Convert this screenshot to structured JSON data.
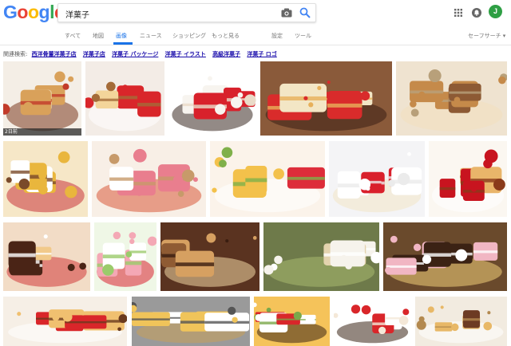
{
  "logo": {
    "letters": [
      {
        "ch": "G",
        "color": "#4285F4"
      },
      {
        "ch": "o",
        "color": "#EA4335"
      },
      {
        "ch": "o",
        "color": "#FBBC05"
      },
      {
        "ch": "g",
        "color": "#4285F4"
      },
      {
        "ch": "l",
        "color": "#34A853"
      },
      {
        "ch": "e",
        "color": "#EA4335"
      }
    ]
  },
  "search": {
    "query": "洋菓子"
  },
  "account": {
    "initial": "J",
    "color": "#2e9f44"
  },
  "tabs": [
    {
      "label": "すべて",
      "active": false
    },
    {
      "label": "地図",
      "active": false
    },
    {
      "label": "画像",
      "active": true
    },
    {
      "label": "ニュース",
      "active": false
    },
    {
      "label": "ショッピング",
      "active": false
    },
    {
      "label": "もっと見る",
      "active": false
    },
    {
      "label": "設定",
      "active": false
    },
    {
      "label": "ツール",
      "active": false
    }
  ],
  "safesearch": "セーフサーチ ▾",
  "related": {
    "label": "関連検索:",
    "items": [
      "西洋骨董洋菓子店",
      "洋菓子店",
      "洋菓子 パッケージ",
      "洋菓子 イラスト",
      "高級洋菓子",
      "洋菓子 ロゴ"
    ]
  },
  "results": [
    {
      "name": "pastry-assortment",
      "bg": "#f4eee6",
      "colors": [
        "#d9a15a",
        "#e8c998",
        "#7b3b1f",
        "#c23b2a"
      ],
      "badge": "2日前"
    },
    {
      "name": "strawberry-tart",
      "bg": "#f3ece6",
      "colors": [
        "#d9262a",
        "#f3d59a",
        "#ffffff",
        "#a46b38"
      ]
    },
    {
      "name": "strawberry-cake-white",
      "bg": "#ffffff",
      "colors": [
        "#f7f4ef",
        "#d8212b",
        "#3a2a22",
        "#eadbc8"
      ]
    },
    {
      "name": "fruit-torte",
      "bg": "#8a5a3a",
      "colors": [
        "#d92b2b",
        "#f3e6c5",
        "#3b1f14",
        "#e7b05a"
      ]
    },
    {
      "name": "baked-cookies",
      "bg": "#efe3d0",
      "colors": [
        "#c58a4a",
        "#8d5a34",
        "#f2e0bd",
        "#b8a07a"
      ]
    },
    {
      "name": "petit-cakes-many",
      "bg": "#f6e7c7",
      "colors": [
        "#e9b63d",
        "#ffffff",
        "#c8353a",
        "#7a4a2a"
      ]
    },
    {
      "name": "petit-fours-pink",
      "bg": "#f8efe6",
      "colors": [
        "#e97e8e",
        "#ffffff",
        "#d85a3a",
        "#c79a6a"
      ]
    },
    {
      "name": "mixed-cakes-fruit",
      "bg": "#fbf3ea",
      "colors": [
        "#f3c14b",
        "#dd2d3a",
        "#ffffff",
        "#7fb04a"
      ]
    },
    {
      "name": "shortcake-slice",
      "bg": "#f4f4f6",
      "colors": [
        "#ffffff",
        "#d9202c",
        "#f2e5c6",
        "#ebebeb"
      ]
    },
    {
      "name": "red-tart-slice",
      "bg": "#fbf7f1",
      "colors": [
        "#c8141f",
        "#e9b56a",
        "#ffffff",
        "#8a3a1a"
      ]
    },
    {
      "name": "chocolate-slices",
      "bg": "#f2dcc6",
      "colors": [
        "#4a2416",
        "#f1c98a",
        "#d23a3a",
        "#ffffff"
      ]
    },
    {
      "name": "strawberry-layer",
      "bg": "#eff7e6",
      "colors": [
        "#f4a8b5",
        "#ffffff",
        "#d8232f",
        "#9bcb6b"
      ]
    },
    {
      "name": "cookie-box",
      "bg": "#5a3320",
      "colors": [
        "#d6a061",
        "#8f5b33",
        "#f3d7a4",
        "#3a1d10"
      ]
    },
    {
      "name": "souffle-pancakes",
      "bg": "#6e7a4a",
      "colors": [
        "#f6f3ec",
        "#e3d3ae",
        "#a9b970",
        "#ffffff"
      ]
    },
    {
      "name": "donuts",
      "bg": "#6a4a2c",
      "colors": [
        "#f1b6c3",
        "#3b2214",
        "#f0d07a",
        "#ffffff"
      ]
    },
    {
      "name": "roll-cake",
      "bg": "#f6efe6",
      "colors": [
        "#f0c070",
        "#d9262a",
        "#ffffff",
        "#6a3a1e"
      ]
    },
    {
      "name": "castella-cubes",
      "bg": "#9a9a9a",
      "colors": [
        "#f0c45a",
        "#ffffff",
        "#c8a05a",
        "#555555"
      ]
    },
    {
      "name": "birthday-cake",
      "bg": "#f5c35a",
      "colors": [
        "#ffffff",
        "#d9262a",
        "#3a2416",
        "#7aa84a"
      ]
    },
    {
      "name": "strawberry-cups",
      "bg": "#ffffff",
      "colors": [
        "#d9262a",
        "#ffffff",
        "#3a2416",
        "#f4e8d8"
      ]
    },
    {
      "name": "pound-cake",
      "bg": "#f2ebe0",
      "colors": [
        "#e8b867",
        "#6d3b23",
        "#ffffff",
        "#b3894f"
      ]
    }
  ]
}
